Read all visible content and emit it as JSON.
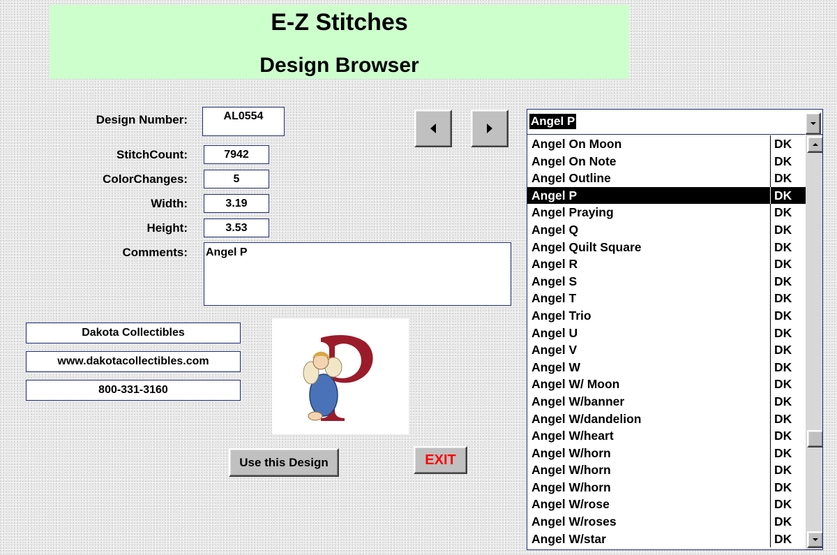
{
  "header": {
    "title": "E-Z Stitches",
    "subtitle": "Design Browser"
  },
  "fields": {
    "design_number": {
      "label": "Design Number:",
      "value": "AL0554"
    },
    "stitch_count": {
      "label": "StitchCount:",
      "value": "7942"
    },
    "color_changes": {
      "label": "ColorChanges:",
      "value": "5"
    },
    "width": {
      "label": "Width:",
      "value": "3.19"
    },
    "height": {
      "label": "Height:",
      "value": "3.53"
    },
    "comments": {
      "label": "Comments:",
      "value": "Angel P"
    }
  },
  "company": {
    "name": "Dakota Collectibles",
    "website": "www.dakotacollectibles.com",
    "phone": "800-331-3160"
  },
  "nav": {
    "prev_icon": "triangle-left-icon",
    "next_icon": "triangle-right-icon"
  },
  "combo": {
    "selected": "Angel P",
    "dropdown_icon": "chevron-down-icon"
  },
  "list": {
    "items": [
      {
        "name": "Angel On Moon",
        "code": "DK"
      },
      {
        "name": "Angel On Note",
        "code": "DK"
      },
      {
        "name": "Angel Outline",
        "code": "DK"
      },
      {
        "name": "Angel P",
        "code": "DK",
        "selected": true
      },
      {
        "name": "Angel Praying",
        "code": "DK"
      },
      {
        "name": "Angel Q",
        "code": "DK"
      },
      {
        "name": "Angel Quilt Square",
        "code": "DK"
      },
      {
        "name": "Angel R",
        "code": "DK"
      },
      {
        "name": "Angel S",
        "code": "DK"
      },
      {
        "name": "Angel T",
        "code": "DK"
      },
      {
        "name": "Angel Trio",
        "code": "DK"
      },
      {
        "name": "Angel U",
        "code": "DK"
      },
      {
        "name": "Angel V",
        "code": "DK"
      },
      {
        "name": "Angel W",
        "code": "DK"
      },
      {
        "name": "Angel W/ Moon",
        "code": "DK"
      },
      {
        "name": "Angel W/banner",
        "code": "DK"
      },
      {
        "name": "Angel W/dandelion",
        "code": "DK"
      },
      {
        "name": "Angel W/heart",
        "code": "DK"
      },
      {
        "name": "Angel W/horn",
        "code": "DK"
      },
      {
        "name": "Angel W/horn",
        "code": "DK"
      },
      {
        "name": "Angel W/horn",
        "code": "DK"
      },
      {
        "name": "Angel W/rose",
        "code": "DK"
      },
      {
        "name": "Angel W/roses",
        "code": "DK"
      },
      {
        "name": "Angel W/star",
        "code": "DK"
      }
    ]
  },
  "buttons": {
    "use_design": "Use this Design",
    "exit": "EXIT"
  },
  "colors": {
    "header_bg": "#ccffcc",
    "exit_text": "#ff0000",
    "field_border": "#1f2a7a",
    "logo_letter": "#9b1b2a"
  }
}
